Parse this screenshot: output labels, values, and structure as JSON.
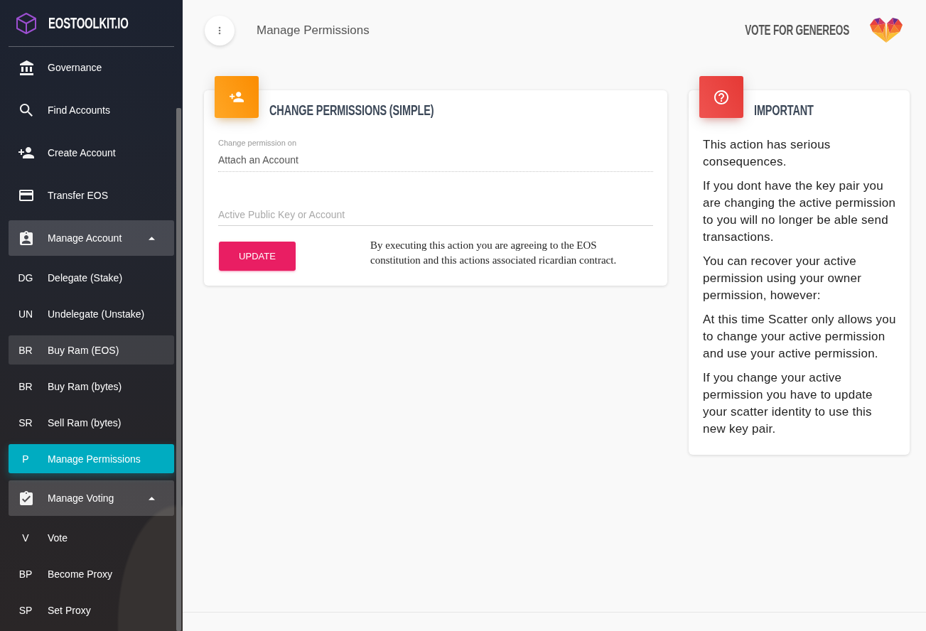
{
  "sidebar": {
    "logo": {
      "text": "EOSTOOLKIT.IO"
    },
    "items": [
      {
        "kind": "link",
        "label": "Governance",
        "selected": false
      },
      {
        "kind": "link",
        "label": "Find Accounts",
        "selected": false
      },
      {
        "kind": "link",
        "label": "Create Account",
        "selected": false
      },
      {
        "kind": "link",
        "label": "Transfer EOS",
        "selected": false
      },
      {
        "kind": "group",
        "label": "Manage Account",
        "selected": false,
        "expanded": true,
        "children": [
          {
            "abbr": "DG",
            "label": "Delegate (Stake)",
            "selected": false,
            "hovered": false
          },
          {
            "abbr": "UN",
            "label": "Undelegate (Unstake)",
            "selected": false,
            "hovered": false
          },
          {
            "abbr": "BR",
            "label": "Buy Ram (EOS)",
            "selected": false,
            "hovered": true
          },
          {
            "abbr": "BR",
            "label": "Buy Ram (bytes)",
            "selected": false,
            "hovered": false
          },
          {
            "abbr": "SR",
            "label": "Sell Ram (bytes)",
            "selected": false,
            "hovered": false
          },
          {
            "abbr": "P",
            "label": "Manage Permissions",
            "selected": true,
            "hovered": false
          }
        ]
      },
      {
        "kind": "group",
        "label": "Manage Voting",
        "selected": false,
        "expanded": true,
        "children": [
          {
            "abbr": "V",
            "label": "Vote",
            "selected": false,
            "hovered": false
          },
          {
            "abbr": "BP",
            "label": "Become Proxy",
            "selected": false,
            "hovered": false
          },
          {
            "abbr": "SP",
            "label": "Set Proxy",
            "selected": false,
            "hovered": false
          }
        ]
      }
    ]
  },
  "header": {
    "title": "Manage Permissions",
    "vote_link": "VOTE FOR GENEREOS"
  },
  "cards": [
    {
      "kind": "form",
      "title": "CHANGE PERMISSIONS (SIMPLE)",
      "fields": [
        {
          "label": "Change permission on",
          "value": "Attach an Account",
          "disabled": true
        },
        {
          "placeholder": "Active Public Key or Account",
          "disabled": false
        }
      ],
      "button": "UPDATE",
      "notice": "By executing this action you are agreeing to the EOS constitution and this actions associated ricardian contract."
    },
    {
      "kind": "info",
      "title": "IMPORTANT",
      "paragraphs": [
        "This action has serious consequences.",
        "If you dont have the key pair you are changing the active permission to you will no longer be able send transactions.",
        "You can recover your active permission using your owner permission, however:",
        "At this time Scatter only allows you to change your active permission and use your active permission.",
        "If you change your active permission you have to update your scatter identity to use this new key pair."
      ]
    }
  ]
}
